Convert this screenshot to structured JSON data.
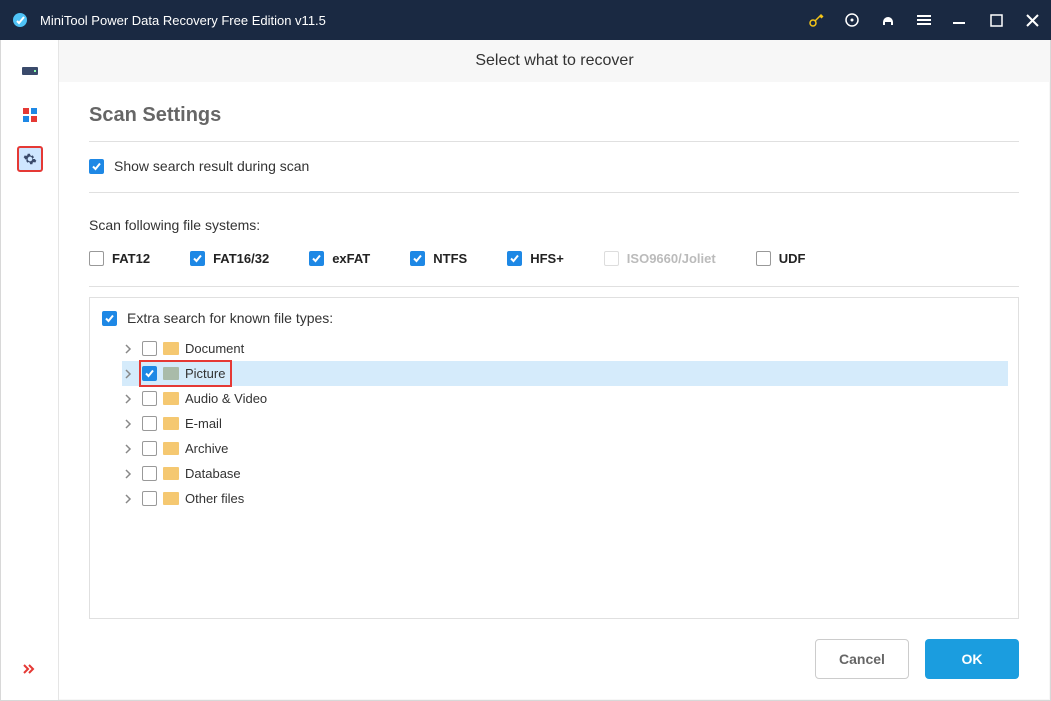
{
  "titlebar": {
    "app_title": "MiniTool Power Data Recovery Free Edition v11.5"
  },
  "main": {
    "banner": "Select what to recover",
    "heading": "Scan Settings",
    "show_search_label": "Show search result during scan",
    "fs_label": "Scan following file systems:",
    "fs": [
      {
        "label": "FAT12",
        "checked": false,
        "disabled": false
      },
      {
        "label": "FAT16/32",
        "checked": true,
        "disabled": false
      },
      {
        "label": "exFAT",
        "checked": true,
        "disabled": false
      },
      {
        "label": "NTFS",
        "checked": true,
        "disabled": false
      },
      {
        "label": "HFS+",
        "checked": true,
        "disabled": false
      },
      {
        "label": "ISO9660/Joliet",
        "checked": false,
        "disabled": true
      },
      {
        "label": "UDF",
        "checked": false,
        "disabled": false
      }
    ],
    "extra_label": "Extra search for known file types:",
    "tree": [
      {
        "label": "Document",
        "checked": false,
        "selected": false
      },
      {
        "label": "Picture",
        "checked": true,
        "selected": true
      },
      {
        "label": "Audio & Video",
        "checked": false,
        "selected": false
      },
      {
        "label": "E-mail",
        "checked": false,
        "selected": false
      },
      {
        "label": "Archive",
        "checked": false,
        "selected": false
      },
      {
        "label": "Database",
        "checked": false,
        "selected": false
      },
      {
        "label": "Other files",
        "checked": false,
        "selected": false
      }
    ],
    "buttons": {
      "cancel": "Cancel",
      "ok": "OK"
    }
  }
}
